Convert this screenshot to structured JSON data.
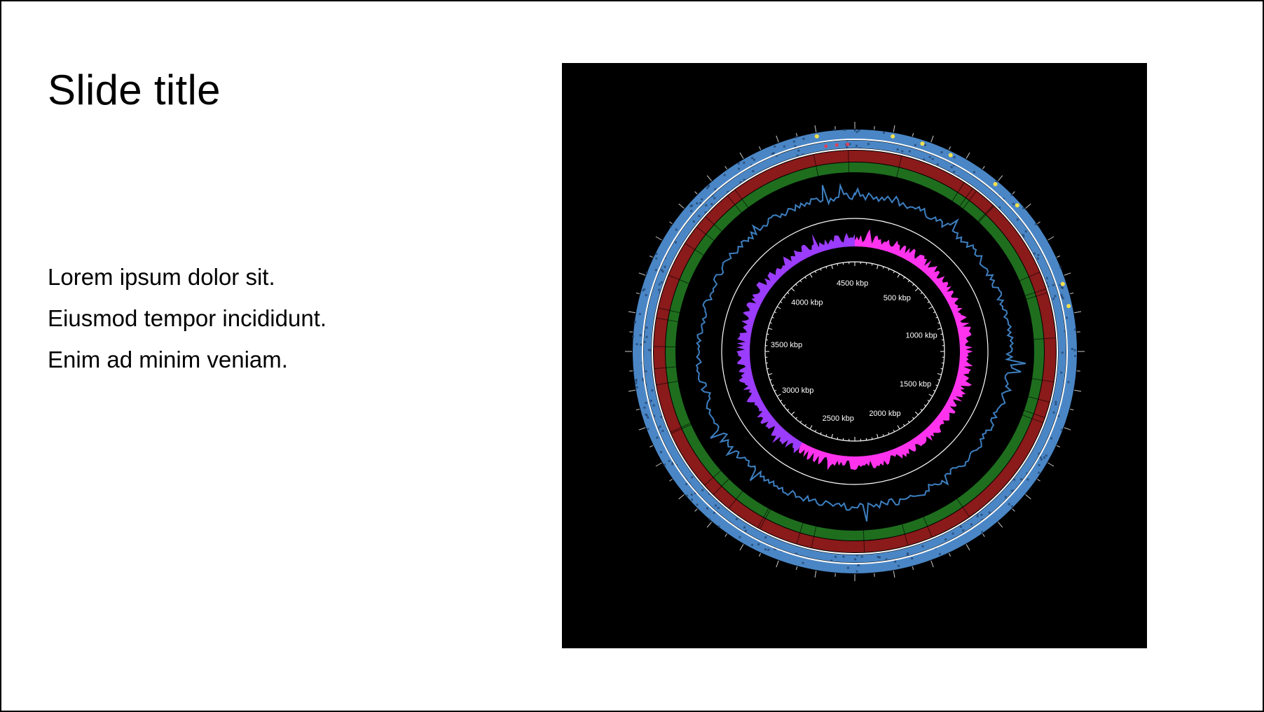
{
  "slide": {
    "title": "Slide title",
    "bullets": [
      "Lorem ipsum dolor sit.",
      "Eiusmod tempor incididunt.",
      "Enim ad minim veniam."
    ]
  },
  "genome_map": {
    "scale_labels": [
      "500 kbp",
      "1000 kbp",
      "1500 kbp",
      "2000 kbp",
      "2500 kbp",
      "3000 kbp",
      "3500 kbp",
      "4000 kbp",
      "4500 kbp"
    ],
    "colors": {
      "background": "#000000",
      "gene_tracks": "#4a86c5",
      "red_track": "#8b1a1a",
      "green_track": "#1e6e1e",
      "gc_content": "#3d7fc0",
      "gc_skew_positive": "#ff33ee",
      "gc_skew_negative": "#9b3cff",
      "rings": "#ffffff",
      "highlight_features": "#f4e04d"
    }
  }
}
